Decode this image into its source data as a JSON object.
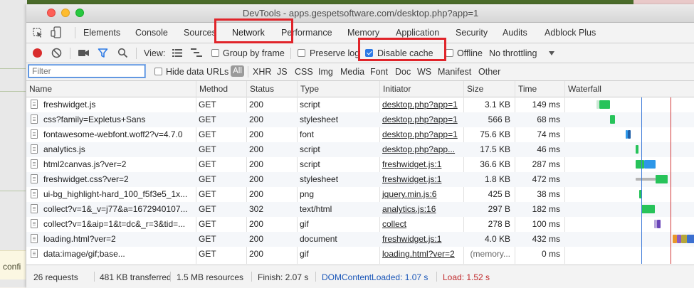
{
  "background": {
    "confirm_text": "confi"
  },
  "window": {
    "title": "DevTools - apps.gespetsoftware.com/desktop.php?app=1"
  },
  "tabs": [
    "Elements",
    "Console",
    "Sources",
    "Network",
    "Performance",
    "Memory",
    "Application",
    "Security",
    "Audits",
    "Adblock Plus"
  ],
  "toolbar": {
    "view_label": "View:",
    "group_by_frame": "Group by frame",
    "preserve_log": "Preserve log",
    "disable_cache": "Disable cache",
    "offline": "Offline",
    "throttling": "No throttling"
  },
  "filterbar": {
    "placeholder": "Filter",
    "hide_data_urls": "Hide data URLs",
    "all": "All",
    "types": [
      "XHR",
      "JS",
      "CSS",
      "Img",
      "Media",
      "Font",
      "Doc",
      "WS",
      "Manifest",
      "Other"
    ]
  },
  "columns": [
    "Name",
    "Method",
    "Status",
    "Type",
    "Initiator",
    "Size",
    "Time",
    "Waterfall"
  ],
  "requests": [
    {
      "name": "freshwidget.js",
      "method": "GET",
      "status": "200",
      "type": "script",
      "initiator": "desktop.php?app=1",
      "size": "3.1 KB",
      "time": "149 ms"
    },
    {
      "name": "css?family=Expletus+Sans",
      "method": "GET",
      "status": "200",
      "type": "stylesheet",
      "initiator": "desktop.php?app=1",
      "size": "566 B",
      "time": "68 ms"
    },
    {
      "name": "fontawesome-webfont.woff2?v=4.7.0",
      "method": "GET",
      "status": "200",
      "type": "font",
      "initiator": "desktop.php?app=1",
      "size": "75.6 KB",
      "time": "74 ms"
    },
    {
      "name": "analytics.js",
      "method": "GET",
      "status": "200",
      "type": "script",
      "initiator": "desktop.php?app...",
      "size": "17.5 KB",
      "time": "46 ms"
    },
    {
      "name": "html2canvas.js?ver=2",
      "method": "GET",
      "status": "200",
      "type": "script",
      "initiator": "freshwidget.js:1",
      "size": "36.6 KB",
      "time": "287 ms"
    },
    {
      "name": "freshwidget.css?ver=2",
      "method": "GET",
      "status": "200",
      "type": "stylesheet",
      "initiator": "freshwidget.js:1",
      "size": "1.8 KB",
      "time": "472 ms"
    },
    {
      "name": "ui-bg_highlight-hard_100_f5f3e5_1x...",
      "method": "GET",
      "status": "200",
      "type": "png",
      "initiator": "jquery.min.js:6",
      "size": "425 B",
      "time": "38 ms"
    },
    {
      "name": "collect?v=1&_v=j77&a=1672940107...",
      "method": "GET",
      "status": "302",
      "type": "text/html",
      "initiator": "analytics.js:16",
      "size": "297 B",
      "time": "182 ms"
    },
    {
      "name": "collect?v=1&aip=1&t=dc&_r=3&tid=...",
      "method": "GET",
      "status": "200",
      "type": "gif",
      "initiator": "collect",
      "size": "278 B",
      "time": "100 ms"
    },
    {
      "name": "loading.html?ver=2",
      "method": "GET",
      "status": "200",
      "type": "document",
      "initiator": "freshwidget.js:1",
      "size": "4.0 KB",
      "time": "432 ms"
    },
    {
      "name": "data:image/gif;base...",
      "method": "GET",
      "status": "200",
      "type": "gif",
      "initiator": "loading.html?ver=2",
      "size": "(memory...",
      "time": "0 ms"
    }
  ],
  "status": {
    "requests": "26 requests",
    "transferred": "481 KB transferred",
    "resources": "1.5 MB resources",
    "finish": "Finish: 2.07 s",
    "dom": "DOMContentLoaded: 1.07 s",
    "load": "Load: 1.52 s"
  },
  "colors": {
    "dom_content_loaded": "#1a56b8",
    "load": "#c0282a",
    "highlight": "#e0242a",
    "waterfall_green": "#27c35a",
    "waterfall_blue": "#2d97e8"
  }
}
